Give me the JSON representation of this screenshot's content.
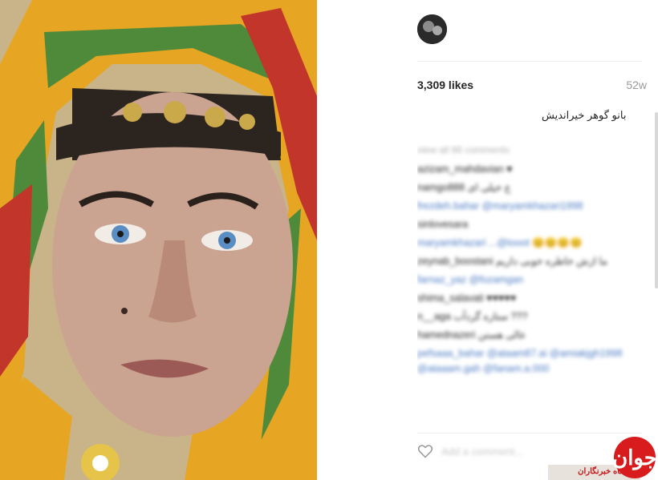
{
  "post": {
    "likes": "3,309 likes",
    "age": "52w",
    "caption": "بانو گوهر خیراندیش"
  },
  "comments": {
    "view_all": "view all 86 comments",
    "items": [
      {
        "user": "az",
        "text": "azizam_mahdavian ♥",
        "link": false
      },
      {
        "user": "na",
        "text": "namgo888 ع خیلی ای",
        "link": false
      },
      {
        "user": "fr",
        "text": "frezdeh.bahar @maryamkhazari1998",
        "link": true
      },
      {
        "user": "si",
        "text": "sinlovesara",
        "link": false
      },
      {
        "user": "m",
        "text": "maryamkhazari ...@tooot 😊😊😊😊",
        "link": true
      },
      {
        "user": "ze",
        "text": "zeynab_boostani ما ازش خاطره خوبی داریم",
        "link": false
      },
      {
        "user": "fa",
        "text": "farnaz_yaz @fozamgan",
        "link": true
      },
      {
        "user": "sh",
        "text": "shima_salavati ♥♥♥♥♥",
        "link": false
      },
      {
        "user": "n",
        "text": "n__aga ستاره گردآب ???",
        "link": false
      },
      {
        "user": "ha",
        "text": "hamednazeri عالی هستن",
        "link": false
      },
      {
        "user": "pe",
        "text": "pefsaaa_bahar @ataam87.ai @amiakjgh1998 @ataaam.gah @fanam.a.000",
        "link": true
      }
    ]
  },
  "add_comment": {
    "placeholder": "Add a comment..."
  },
  "watermark": {
    "text": "باشگاه خبرنگاران",
    "mark": "جوان"
  },
  "colors": {
    "scarf_yellow": "#e6a623",
    "scarf_green": "#4f8a3a",
    "scarf_red": "#c2352a",
    "logo_red": "#d81c1e",
    "link_blue": "#4b7bc4"
  }
}
